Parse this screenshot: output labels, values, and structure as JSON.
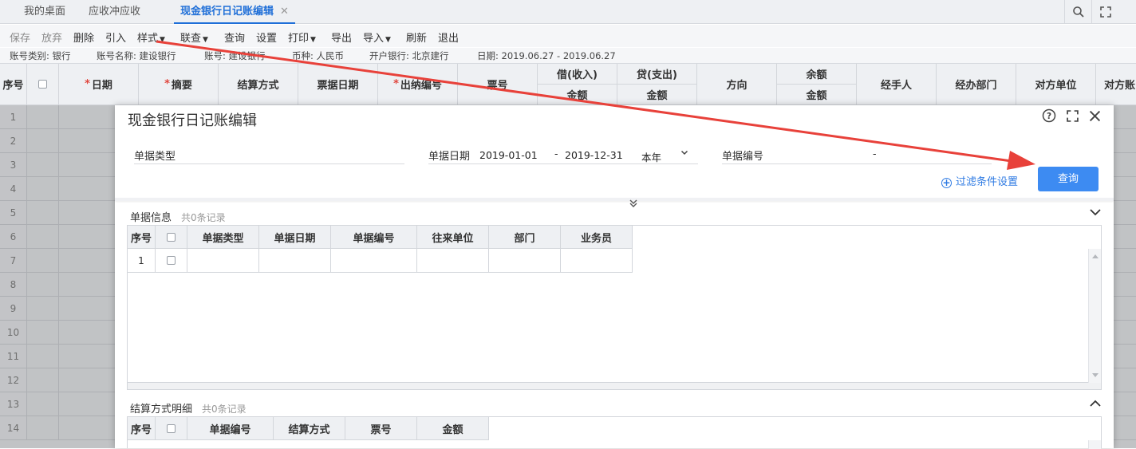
{
  "tabs": [
    {
      "label": "我的桌面"
    },
    {
      "label": "应收冲应收"
    },
    {
      "label": "现金银行日记账编辑",
      "close": "✕"
    }
  ],
  "toolbar": {
    "items": [
      {
        "label": "保存"
      },
      {
        "label": "放弃"
      },
      {
        "label": "删除"
      },
      {
        "label": "引入"
      },
      {
        "label": "样式"
      },
      {
        "label": "联查"
      },
      {
        "label": "查询"
      },
      {
        "label": "设置"
      },
      {
        "label": "打印"
      },
      {
        "label": "导出"
      },
      {
        "label": "导入"
      },
      {
        "label": "刷新"
      },
      {
        "label": "退出"
      }
    ]
  },
  "info": {
    "account_type": "账号类别: 银行",
    "account_name": "账号名称: 建设银行",
    "account_no": "账号: 建设银行",
    "currency": "币种: 人民币",
    "bank": "开户银行: 北京建行",
    "date": "日期: 2019.06.27 - 2019.06.27"
  },
  "grid": {
    "headers": {
      "seq": "序号",
      "date": "日期",
      "summary": "摘要",
      "settle": "结算方式",
      "bill_date": "票据日期",
      "cashier_no": "出纳编号",
      "bill_no": "票号",
      "debit": "借(收入)",
      "credit": "贷(支出)",
      "amount": "金额",
      "direction": "方向",
      "balance": "余额",
      "handler": "经手人",
      "dept": "经办部门",
      "counter_unit": "对方单位",
      "counter_acct": "对方账"
    },
    "rows": [
      "1",
      "2",
      "3",
      "4",
      "5",
      "6",
      "7",
      "8",
      "9",
      "10",
      "11",
      "12",
      "13",
      "14"
    ]
  },
  "dialog": {
    "title": "现金银行日记账编辑",
    "icons": {
      "help": "help-icon",
      "maximize": "maximize-icon",
      "close": "close-icon"
    },
    "filter": {
      "bill_type_label": "单据类型",
      "bill_date_label": "单据日期",
      "date_from": "2019-01-01",
      "date_sep": "-",
      "date_to": "2019-12-31",
      "period": "本年",
      "bill_no_label": "单据编号",
      "bill_no_sep": "-",
      "filter_settings": "过滤条件设置",
      "query": "查询"
    },
    "bill_info": {
      "title": "单据信息",
      "count": "共0条记录",
      "headers": [
        "序号",
        "",
        "单据类型",
        "单据日期",
        "单据编号",
        "往来单位",
        "部门",
        "业务员"
      ],
      "rows": [
        {
          "seq": "1"
        }
      ]
    },
    "settle_detail": {
      "title": "结算方式明细",
      "count": "共0条记录",
      "headers": [
        "序号",
        "",
        "单据编号",
        "结算方式",
        "票号",
        "金额"
      ]
    }
  },
  "colors": {
    "accent": "#1f6fd8",
    "button": "#3d8bf2",
    "arrow": "#e8413a"
  }
}
